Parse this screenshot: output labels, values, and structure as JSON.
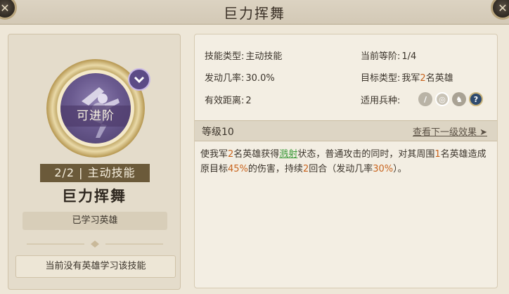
{
  "window": {
    "title": "巨力挥舞",
    "close_icon": "close-icon"
  },
  "left": {
    "emblem_label": "可进阶",
    "level_tag": "2/2 | 主动技能",
    "skill_name": "巨力挥舞",
    "learned_label": "已学习英雄",
    "no_hero_text": "当前没有英雄学习该技能"
  },
  "stats": {
    "type_label": "技能类型:",
    "type_value": "主动技能",
    "rate_label": "发动几率:",
    "rate_value": "30.0%",
    "range_label": "有效距离:",
    "range_value": "2",
    "tier_label": "当前等阶:",
    "tier_value": "1/4",
    "target_label": "目标类型:",
    "target_prefix": "我军",
    "target_count": "2",
    "target_suffix": "名英雄",
    "troop_label": "适用兵种:",
    "troops": [
      "infantry-icon",
      "shield-icon",
      "cavalry-icon",
      "question-icon"
    ]
  },
  "level": {
    "label": "等级10",
    "next_link": "查看下一级效果 ➤"
  },
  "description": {
    "p1": "使我军",
    "n1": "2",
    "p2": "名英雄获得",
    "status": "溅射",
    "p3": "状态，普通攻击的同时，对其周围",
    "n2": "1",
    "p4": "名英雄造成原目标",
    "n3": "45%",
    "p5": "的伤害，持续",
    "n4": "2",
    "p6": "回合（发动几率",
    "n5": "30%",
    "p7": "）。"
  },
  "colors": {
    "accent_orange": "#c8641e",
    "status_green": "#3c9a3a",
    "emblem_purple": "#6a5a8f"
  }
}
